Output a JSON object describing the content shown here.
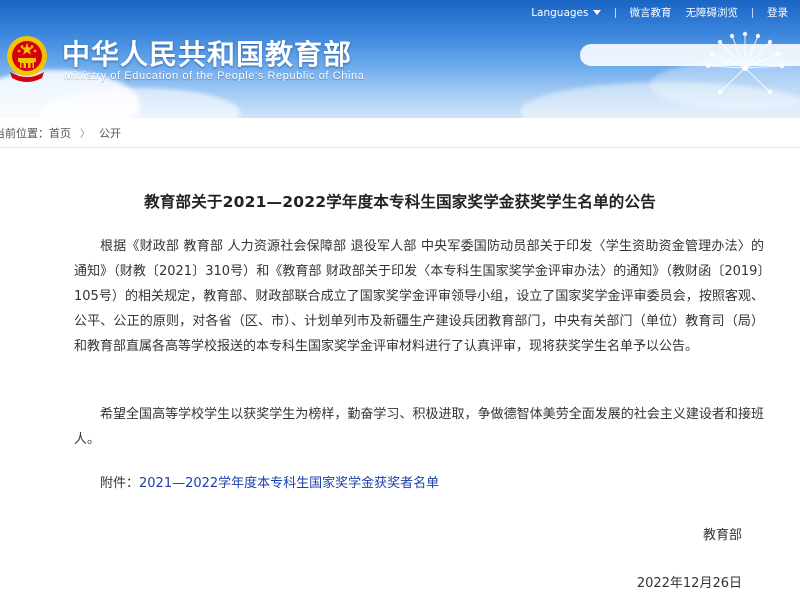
{
  "header": {
    "title": "中华人民共和国教育部",
    "subtitle": "Ministry of Education of the People's Republic of China",
    "nav": {
      "languages": "Languages",
      "weibo": "微言教育",
      "accessible": "无障碍浏览",
      "login": "登录"
    },
    "search": {
      "value": "",
      "placeholder": ""
    }
  },
  "breadcrumb": {
    "prefix": "当前位置：",
    "items": [
      "首页",
      "公开"
    ],
    "separator": "〉"
  },
  "article": {
    "title": "教育部关于2021—2022学年度本专科生国家奖学金获奖学生名单的公告",
    "paragraphs": [
      "根据《财政部 教育部 人力资源社会保障部 退役军人部 中央军委国防动员部关于印发〈学生资助资金管理办法〉的通知》（财教〔2021〕310号）和《教育部 财政部关于印发〈本专科生国家奖学金评审办法〉的通知》（教财函〔2019〕105号）的相关规定，教育部、财政部联合成立了国家奖学金评审领导小组，设立了国家奖学金评审委员会，按照客观、公平、公正的原则，对各省（区、市）、计划单列市及新疆生产建设兵团教育部门，中央有关部门（单位）教育司（局）和教育部直属各高等学校报送的本专科生国家奖学金评审材料进行了认真评审，现将获奖学生名单予以公告。",
      "希望全国高等学校学生以获奖学生为榜样，勤奋学习、积极进取，争做德智体美劳全面发展的社会主义建设者和接班人。"
    ],
    "attachment_label": "附件：",
    "attachment_link": "2021—2022学年度本专科生国家奖学金获奖者名单",
    "signature": "教育部",
    "date": "2022年12月26日"
  },
  "colors": {
    "banner_top": "#1a64c4",
    "banner_bottom": "#cfe4f9",
    "link": "#1a3fa8",
    "emblem_red": "#d7000f",
    "emblem_gold": "#f4c400"
  },
  "icons": {
    "emblem": "national-emblem-icon",
    "dropdown": "caret-down-icon"
  }
}
